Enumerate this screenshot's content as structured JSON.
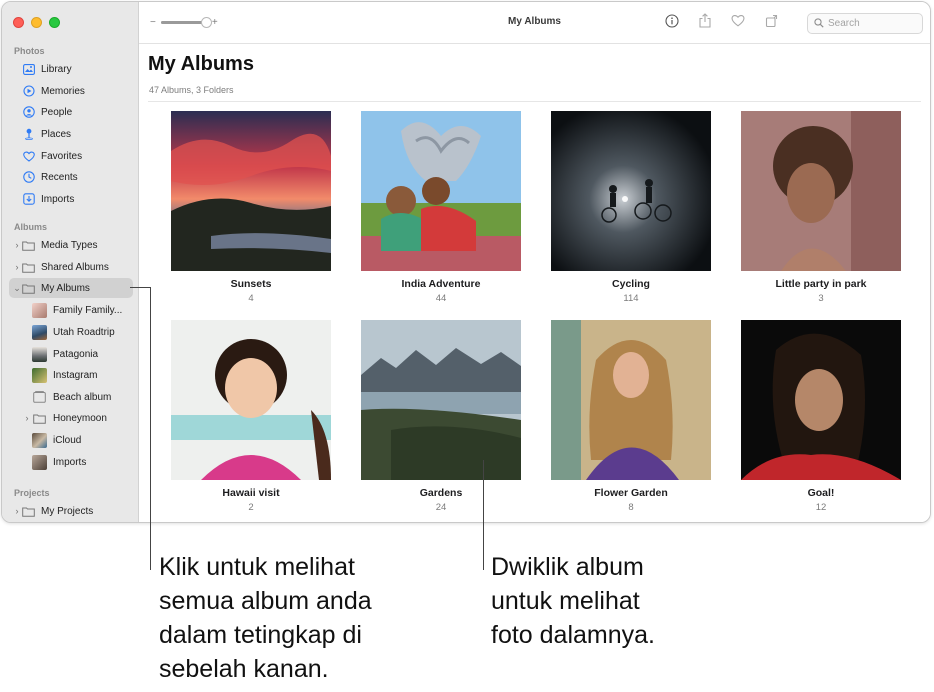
{
  "window": {
    "title": "My Albums"
  },
  "sidebar": {
    "sections": {
      "photos": "Photos",
      "albums": "Albums",
      "projects": "Projects"
    },
    "photos_items": [
      {
        "label": "Library",
        "icon": "library-icon"
      },
      {
        "label": "Memories",
        "icon": "memories-icon"
      },
      {
        "label": "People",
        "icon": "people-icon"
      },
      {
        "label": "Places",
        "icon": "places-icon"
      },
      {
        "label": "Favorites",
        "icon": "heart-icon"
      },
      {
        "label": "Recents",
        "icon": "clock-icon"
      },
      {
        "label": "Imports",
        "icon": "imports-icon"
      }
    ],
    "album_items": [
      {
        "label": "Media Types"
      },
      {
        "label": "Shared Albums"
      },
      {
        "label": "My Albums",
        "selected": true
      }
    ],
    "my_albums": [
      {
        "label": "Family Family..."
      },
      {
        "label": "Utah Roadtrip"
      },
      {
        "label": "Patagonia"
      },
      {
        "label": "Instagram"
      },
      {
        "label": "Beach album"
      },
      {
        "label": "Honeymoon"
      },
      {
        "label": "iCloud"
      },
      {
        "label": "Imports"
      }
    ],
    "project_items": [
      {
        "label": "My Projects"
      }
    ]
  },
  "toolbar": {
    "zoom_minus": "−",
    "zoom_plus": "+",
    "zoom_level": 1.0,
    "search_placeholder": "Search"
  },
  "main": {
    "title": "My Albums",
    "subtitle": "47 Albums, 3 Folders",
    "albums": [
      {
        "name": "Sunsets",
        "count": "4"
      },
      {
        "name": "India Adventure",
        "count": "44"
      },
      {
        "name": "Cycling",
        "count": "114"
      },
      {
        "name": "Little party in park",
        "count": "3"
      },
      {
        "name": "Hawaii visit",
        "count": "2"
      },
      {
        "name": "Gardens",
        "count": "24"
      },
      {
        "name": "Flower Garden",
        "count": "8"
      },
      {
        "name": "Goal!",
        "count": "12"
      }
    ]
  },
  "callouts": {
    "left": [
      "Klik untuk melihat",
      "semua album anda",
      "dalam tetingkap di",
      "sebelah kanan."
    ],
    "right": [
      "Dwiklik album",
      "untuk melihat",
      "foto dalamnya."
    ]
  },
  "colors": {
    "sidebar_bg": "#e8e8e8",
    "accent": "#2f7bf5",
    "selected_bg": "#d1d1d1"
  }
}
